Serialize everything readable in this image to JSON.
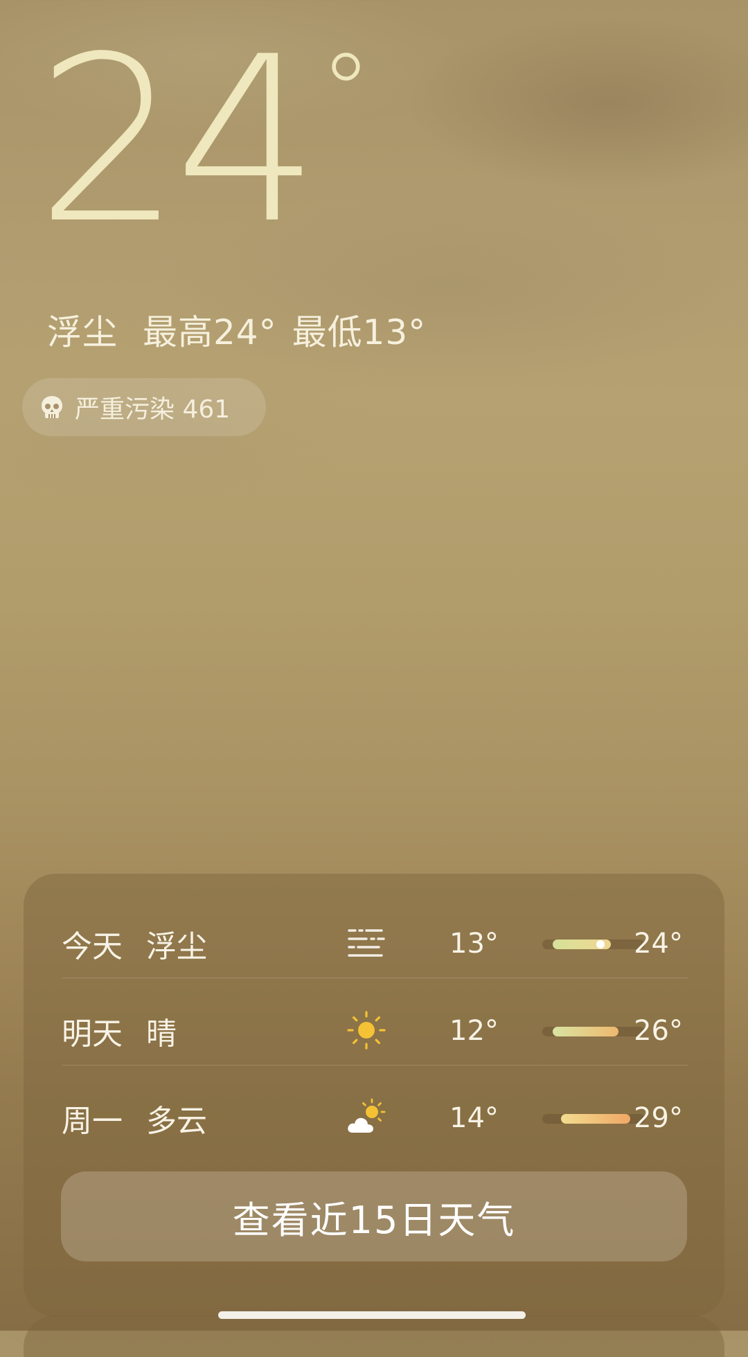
{
  "current": {
    "temperature": "24",
    "degree_symbol": "°",
    "condition": "浮尘",
    "high_label": "最高24°",
    "low_label": "最低13°"
  },
  "air_quality": {
    "icon": "skull-icon",
    "text": "严重污染 461"
  },
  "forecast": [
    {
      "day": "今天",
      "condition": "浮尘",
      "icon": "dust-icon",
      "low": "13°",
      "high": "24°",
      "bar_range": [
        0.1,
        0.67
      ],
      "current_marker": 0.57,
      "colors": [
        "#d6e19a",
        "#f0d690"
      ]
    },
    {
      "day": "明天",
      "condition": "晴",
      "icon": "sun-icon",
      "low": "12°",
      "high": "26°",
      "bar_range": [
        0.1,
        0.74
      ],
      "colors": [
        "#d8e4a2",
        "#efb86e"
      ]
    },
    {
      "day": "周一",
      "condition": "多云",
      "icon": "partly-cloudy-icon",
      "low": "14°",
      "high": "29°",
      "bar_range": [
        0.18,
        0.86
      ],
      "colors": [
        "#f2dc8e",
        "#f0a866"
      ]
    }
  ],
  "cta": {
    "label": "查看近15日天气"
  },
  "colors": {
    "sun": "#f5c235",
    "big_temp": "#efe7bd"
  }
}
